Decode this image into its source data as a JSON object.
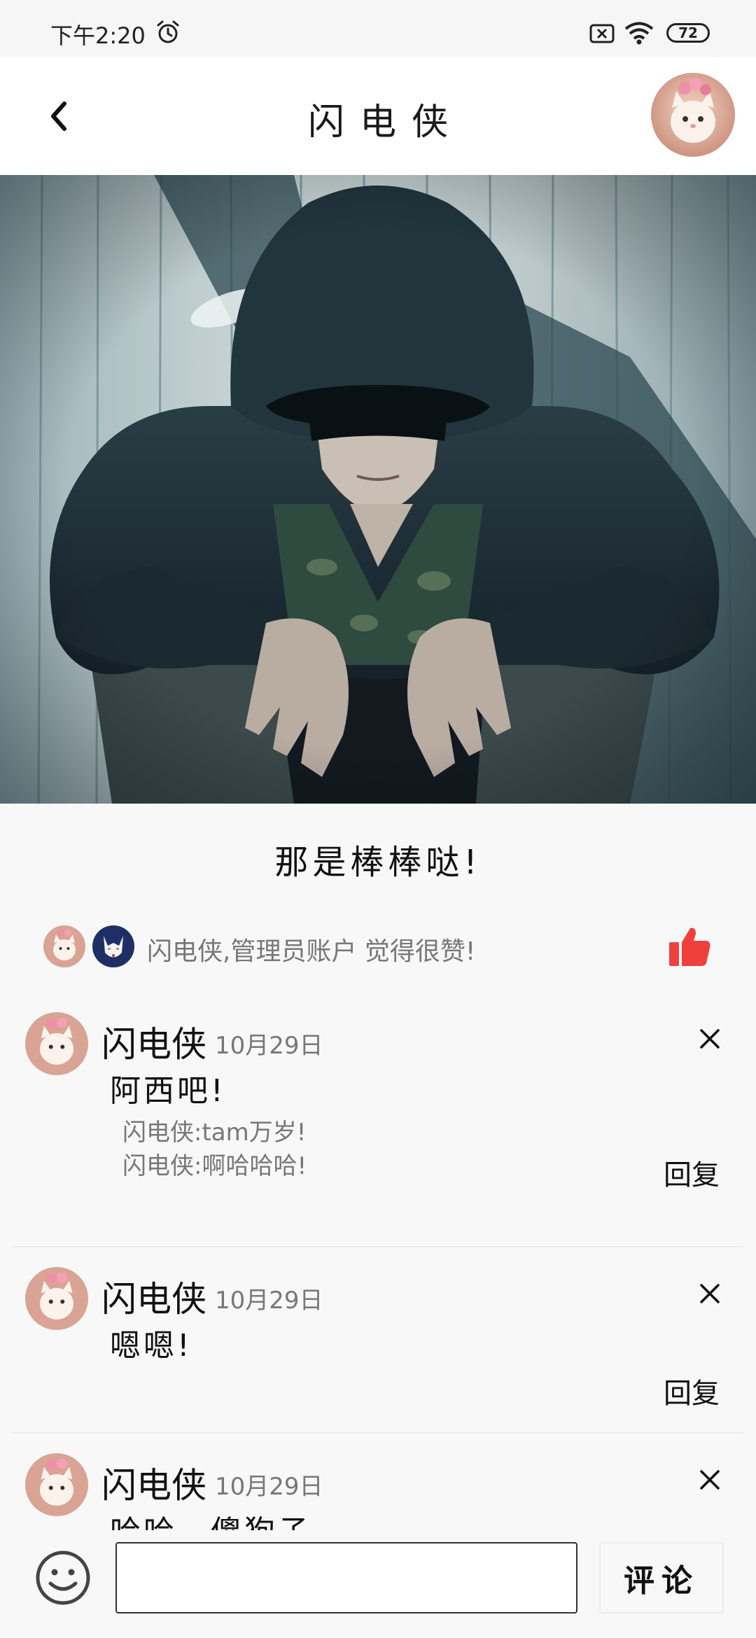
{
  "status_bar": {
    "time": "下午2:20",
    "battery": "72",
    "icons": [
      "alarm-icon",
      "sim-blocked-icon",
      "wifi-icon",
      "battery-icon"
    ]
  },
  "header": {
    "title": "闪电侠",
    "back_icon": "chevron-left-icon"
  },
  "post": {
    "text": "那是棒棒哒!",
    "likes_text": "闪电侠,管理员账户 觉得很赞!",
    "like_icon": "thumbs-up-icon",
    "like_color": "#f0403c"
  },
  "comments": [
    {
      "name": "闪电侠",
      "date": "10月29日",
      "text": "阿西吧!",
      "replies": [
        "闪电侠:tam万岁!",
        "闪电侠:啊哈哈哈!"
      ],
      "reply_label": "回复"
    },
    {
      "name": "闪电侠",
      "date": "10月29日",
      "text": "嗯嗯!",
      "replies": [],
      "reply_label": "回复"
    },
    {
      "name": "闪电侠",
      "date": "10月29日",
      "text": "哈哈，傻狗子",
      "replies": []
    }
  ],
  "bottom_bar": {
    "input_value": "",
    "submit_label": "评论",
    "emoji_icon": "smiley-icon"
  }
}
